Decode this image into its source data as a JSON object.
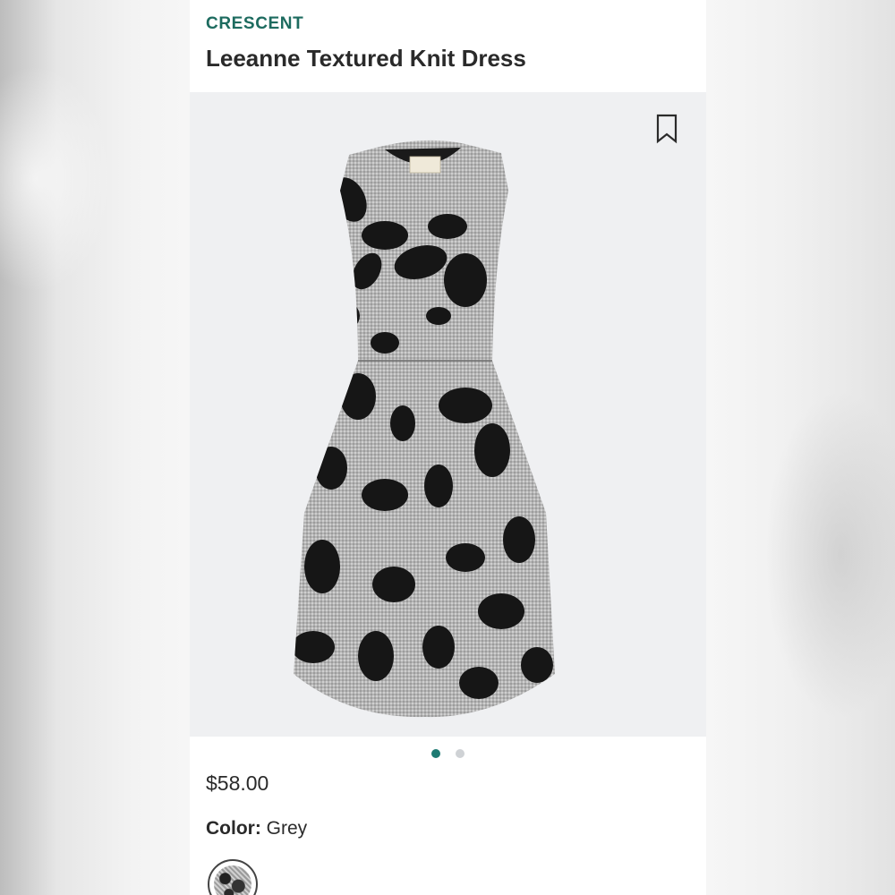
{
  "product": {
    "brand": "CRESCENT",
    "name": "Leeanne Textured Knit Dress",
    "price": "$58.00",
    "color_label": "Color:",
    "color_value": "Grey"
  },
  "gallery": {
    "image_count": 2,
    "active_index": 0,
    "bookmark_icon": "bookmark-icon"
  },
  "colors": {
    "brand_text": "#1d6b5f",
    "active_dot": "#1d7a72",
    "inactive_dot": "#cfd2d5",
    "hero_bg": "#eff0f2"
  }
}
